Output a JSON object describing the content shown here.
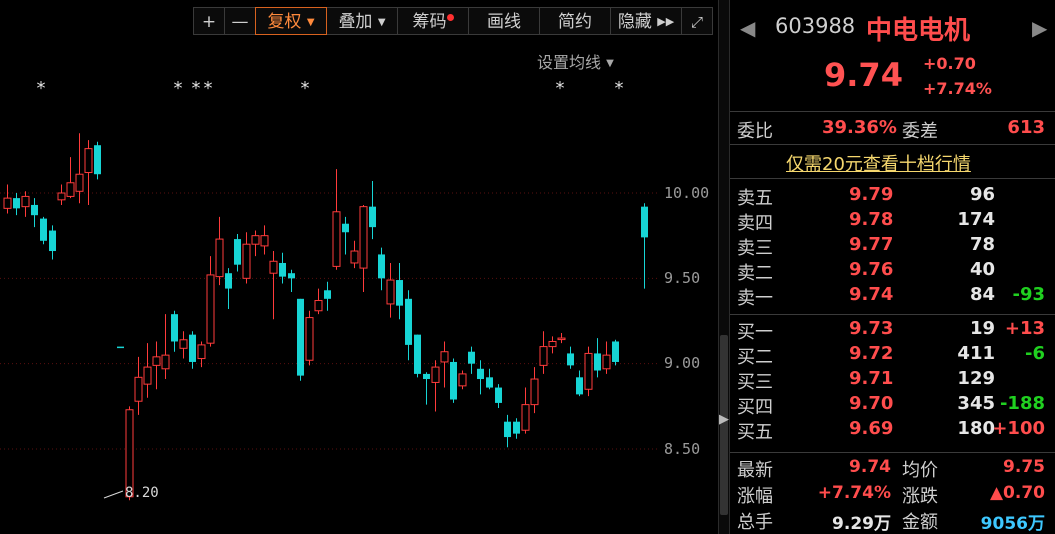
{
  "toolbar": {
    "plus": "+",
    "minus": "—",
    "rights": "复权",
    "overlay": "叠加",
    "chips": "筹码",
    "draw": "画线",
    "simple": "简约",
    "hide": "隐藏",
    "ma_setting": "设置均线"
  },
  "colors": {
    "up": "#ff3b3b",
    "down": "#17d5d5",
    "accent": "#d8621f"
  },
  "chart_data": {
    "type": "candlestick",
    "yticks": [
      "10.00",
      "9.50",
      "9.00",
      "8.50"
    ],
    "low_annotation": "8.20",
    "candles": [
      {
        "o": 9.91,
        "c": 9.97,
        "h": 10.05,
        "l": 9.88,
        "up": true
      },
      {
        "o": 9.97,
        "c": 9.91,
        "h": 10.0,
        "l": 9.87,
        "up": false
      },
      {
        "o": 9.92,
        "c": 9.98,
        "h": 10.01,
        "l": 9.86,
        "up": true
      },
      {
        "o": 9.93,
        "c": 9.87,
        "h": 9.97,
        "l": 9.8,
        "up": false
      },
      {
        "o": 9.85,
        "c": 9.72,
        "h": 9.86,
        "l": 9.7,
        "up": false
      },
      {
        "o": 9.78,
        "c": 9.66,
        "h": 9.81,
        "l": 9.61,
        "up": false
      },
      {
        "o": 9.96,
        "c": 10.0,
        "h": 10.05,
        "l": 9.93,
        "up": true
      },
      {
        "o": 9.98,
        "c": 10.06,
        "h": 10.21,
        "l": 9.97,
        "up": true
      },
      {
        "o": 10.01,
        "c": 10.11,
        "h": 10.35,
        "l": 9.94,
        "up": true
      },
      {
        "o": 10.12,
        "c": 10.26,
        "h": 10.31,
        "l": 9.93,
        "up": true
      },
      {
        "o": 10.28,
        "c": 10.11,
        "h": 10.3,
        "l": 10.08,
        "up": false
      },
      {
        "o": 9.1,
        "c": 9.1,
        "h": 9.1,
        "l": 9.1,
        "up": false
      },
      {
        "o": 8.22,
        "c": 8.73,
        "h": 8.75,
        "l": 8.2,
        "up": true
      },
      {
        "o": 8.78,
        "c": 8.92,
        "h": 9.04,
        "l": 8.7,
        "up": true
      },
      {
        "o": 8.88,
        "c": 8.98,
        "h": 9.12,
        "l": 8.8,
        "up": true
      },
      {
        "o": 8.99,
        "c": 9.04,
        "h": 9.13,
        "l": 8.85,
        "up": true
      },
      {
        "o": 8.97,
        "c": 9.05,
        "h": 9.29,
        "l": 8.91,
        "up": true
      },
      {
        "o": 9.29,
        "c": 9.13,
        "h": 9.31,
        "l": 9.07,
        "up": false
      },
      {
        "o": 9.09,
        "c": 9.14,
        "h": 9.19,
        "l": 9.03,
        "up": true
      },
      {
        "o": 9.17,
        "c": 9.01,
        "h": 9.19,
        "l": 8.97,
        "up": false
      },
      {
        "o": 9.03,
        "c": 9.11,
        "h": 9.13,
        "l": 8.98,
        "up": true
      },
      {
        "o": 9.12,
        "c": 9.52,
        "h": 9.63,
        "l": 9.1,
        "up": true
      },
      {
        "o": 9.51,
        "c": 9.73,
        "h": 9.86,
        "l": 9.46,
        "up": true
      },
      {
        "o": 9.53,
        "c": 9.44,
        "h": 9.56,
        "l": 9.32,
        "up": false
      },
      {
        "o": 9.73,
        "c": 9.58,
        "h": 9.76,
        "l": 9.54,
        "up": false
      },
      {
        "o": 9.5,
        "c": 9.7,
        "h": 9.77,
        "l": 9.47,
        "up": true
      },
      {
        "o": 9.7,
        "c": 9.75,
        "h": 9.78,
        "l": 9.63,
        "up": true
      },
      {
        "o": 9.69,
        "c": 9.75,
        "h": 9.81,
        "l": 9.64,
        "up": true
      },
      {
        "o": 9.53,
        "c": 9.6,
        "h": 9.66,
        "l": 9.26,
        "up": true
      },
      {
        "o": 9.59,
        "c": 9.51,
        "h": 9.65,
        "l": 9.47,
        "up": false
      },
      {
        "o": 9.53,
        "c": 9.5,
        "h": 9.55,
        "l": 9.42,
        "up": false
      },
      {
        "o": 9.38,
        "c": 8.93,
        "h": 9.38,
        "l": 8.9,
        "up": false
      },
      {
        "o": 9.02,
        "c": 9.27,
        "h": 9.31,
        "l": 8.99,
        "up": true
      },
      {
        "o": 9.31,
        "c": 9.37,
        "h": 9.44,
        "l": 9.29,
        "up": true
      },
      {
        "o": 9.43,
        "c": 9.38,
        "h": 9.48,
        "l": 9.31,
        "up": false
      },
      {
        "o": 9.57,
        "c": 9.89,
        "h": 10.14,
        "l": 9.55,
        "up": true
      },
      {
        "o": 9.82,
        "c": 9.77,
        "h": 9.86,
        "l": 9.64,
        "up": false
      },
      {
        "o": 9.59,
        "c": 9.66,
        "h": 9.72,
        "l": 9.56,
        "up": true
      },
      {
        "o": 9.56,
        "c": 9.92,
        "h": 9.93,
        "l": 9.42,
        "up": true
      },
      {
        "o": 9.92,
        "c": 9.8,
        "h": 10.07,
        "l": 9.73,
        "up": false
      },
      {
        "o": 9.64,
        "c": 9.5,
        "h": 9.68,
        "l": 9.43,
        "up": false
      },
      {
        "o": 9.35,
        "c": 9.49,
        "h": 9.59,
        "l": 9.27,
        "up": true
      },
      {
        "o": 9.49,
        "c": 9.34,
        "h": 9.59,
        "l": 9.26,
        "up": false
      },
      {
        "o": 9.38,
        "c": 9.11,
        "h": 9.43,
        "l": 9.02,
        "up": false
      },
      {
        "o": 9.17,
        "c": 8.94,
        "h": 9.17,
        "l": 8.92,
        "up": false
      },
      {
        "o": 8.94,
        "c": 8.91,
        "h": 8.95,
        "l": 8.76,
        "up": false
      },
      {
        "o": 8.89,
        "c": 8.98,
        "h": 9.02,
        "l": 8.72,
        "up": true
      },
      {
        "o": 9.01,
        "c": 9.07,
        "h": 9.13,
        "l": 8.86,
        "up": true
      },
      {
        "o": 9.01,
        "c": 8.79,
        "h": 9.03,
        "l": 8.77,
        "up": false
      },
      {
        "o": 8.87,
        "c": 8.94,
        "h": 8.96,
        "l": 8.85,
        "up": true
      },
      {
        "o": 9.07,
        "c": 9.0,
        "h": 9.1,
        "l": 8.94,
        "up": false
      },
      {
        "o": 8.97,
        "c": 8.91,
        "h": 9.02,
        "l": 8.82,
        "up": false
      },
      {
        "o": 8.92,
        "c": 8.86,
        "h": 8.97,
        "l": 8.85,
        "up": false
      },
      {
        "o": 8.86,
        "c": 8.77,
        "h": 8.88,
        "l": 8.74,
        "up": false
      },
      {
        "o": 8.66,
        "c": 8.57,
        "h": 8.7,
        "l": 8.51,
        "up": false
      },
      {
        "o": 8.66,
        "c": 8.59,
        "h": 8.68,
        "l": 8.56,
        "up": false
      },
      {
        "o": 8.61,
        "c": 8.76,
        "h": 8.86,
        "l": 8.59,
        "up": true
      },
      {
        "o": 8.76,
        "c": 8.91,
        "h": 8.98,
        "l": 8.71,
        "up": true
      },
      {
        "o": 8.99,
        "c": 9.1,
        "h": 9.19,
        "l": 8.94,
        "up": true
      },
      {
        "o": 9.1,
        "c": 9.13,
        "h": 9.16,
        "l": 9.06,
        "up": true
      },
      {
        "o": 9.15,
        "c": 9.15,
        "h": 9.18,
        "l": 9.12,
        "up": true
      },
      {
        "o": 9.06,
        "c": 8.99,
        "h": 9.1,
        "l": 8.97,
        "up": false
      },
      {
        "o": 8.92,
        "c": 8.82,
        "h": 8.96,
        "l": 8.81,
        "up": false
      },
      {
        "o": 8.85,
        "c": 9.06,
        "h": 9.1,
        "l": 8.81,
        "up": true
      },
      {
        "o": 9.06,
        "c": 8.96,
        "h": 9.15,
        "l": 8.92,
        "up": false
      },
      {
        "o": 8.97,
        "c": 9.05,
        "h": 9.13,
        "l": 8.94,
        "up": true
      },
      {
        "o": 9.13,
        "c": 9.01,
        "h": 9.14,
        "l": 8.99,
        "up": false
      },
      {
        "o": 9.92,
        "c": 9.74,
        "h": 9.94,
        "l": 9.44,
        "up": false
      }
    ],
    "stars": [
      "*",
      "*",
      "*",
      "*",
      "*",
      "*",
      "*"
    ]
  },
  "quote": {
    "code": "603988",
    "name": "中电电机",
    "last": "9.74",
    "chg_abs": "+0.70",
    "chg_pct": "+7.74%",
    "weibi_label": "委比",
    "weibi_val": "39.36%",
    "weicha_label": "委差",
    "weicha_val": "613",
    "promo": "仅需20元查看十档行情",
    "asks": [
      {
        "label": "卖五",
        "price": "9.79",
        "vol": "96",
        "delta": ""
      },
      {
        "label": "卖四",
        "price": "9.78",
        "vol": "174",
        "delta": ""
      },
      {
        "label": "卖三",
        "price": "9.77",
        "vol": "78",
        "delta": ""
      },
      {
        "label": "卖二",
        "price": "9.76",
        "vol": "40",
        "delta": ""
      },
      {
        "label": "卖一",
        "price": "9.74",
        "vol": "84",
        "delta": "-93"
      }
    ],
    "bids": [
      {
        "label": "买一",
        "price": "9.73",
        "vol": "19",
        "delta": "+13"
      },
      {
        "label": "买二",
        "price": "9.72",
        "vol": "411",
        "delta": "-6"
      },
      {
        "label": "买三",
        "price": "9.71",
        "vol": "129",
        "delta": ""
      },
      {
        "label": "买四",
        "price": "9.70",
        "vol": "345",
        "delta": "-188"
      },
      {
        "label": "买五",
        "price": "9.69",
        "vol": "180",
        "delta": "+100"
      }
    ],
    "stats": {
      "latest_label": "最新",
      "latest": "9.74",
      "avg_label": "均价",
      "avg": "9.75",
      "pct_label": "涨幅",
      "pct": "+7.74%",
      "chg_label": "涨跌",
      "chg": "▲0.70",
      "vol_label": "总手",
      "vol": "9.29万",
      "amt_label": "金额",
      "amt": "9056万"
    }
  }
}
